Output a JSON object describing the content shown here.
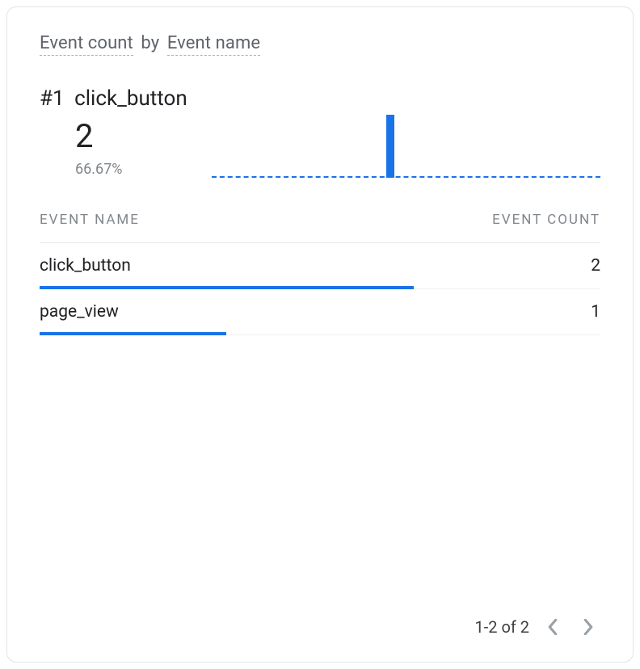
{
  "header": {
    "metric_label": "Event count",
    "by_label": "by",
    "dimension_label": "Event name"
  },
  "hero": {
    "rank": "#1",
    "name": "click_button",
    "value": "2",
    "percent": "66.67%"
  },
  "table": {
    "col_name": "EVENT NAME",
    "col_value": "EVENT COUNT",
    "rows": [
      {
        "name": "click_button",
        "value": "2",
        "bar_pct": 66.67
      },
      {
        "name": "page_view",
        "value": "1",
        "bar_pct": 33.33
      }
    ]
  },
  "pager": {
    "text": "1-2 of 2"
  },
  "chart_data": {
    "type": "bar",
    "title": "Event count by Event name",
    "xlabel": "Event name",
    "ylabel": "Event count",
    "categories": [
      "click_button",
      "page_view"
    ],
    "values": [
      2,
      1
    ],
    "ylim": [
      0,
      2
    ]
  }
}
